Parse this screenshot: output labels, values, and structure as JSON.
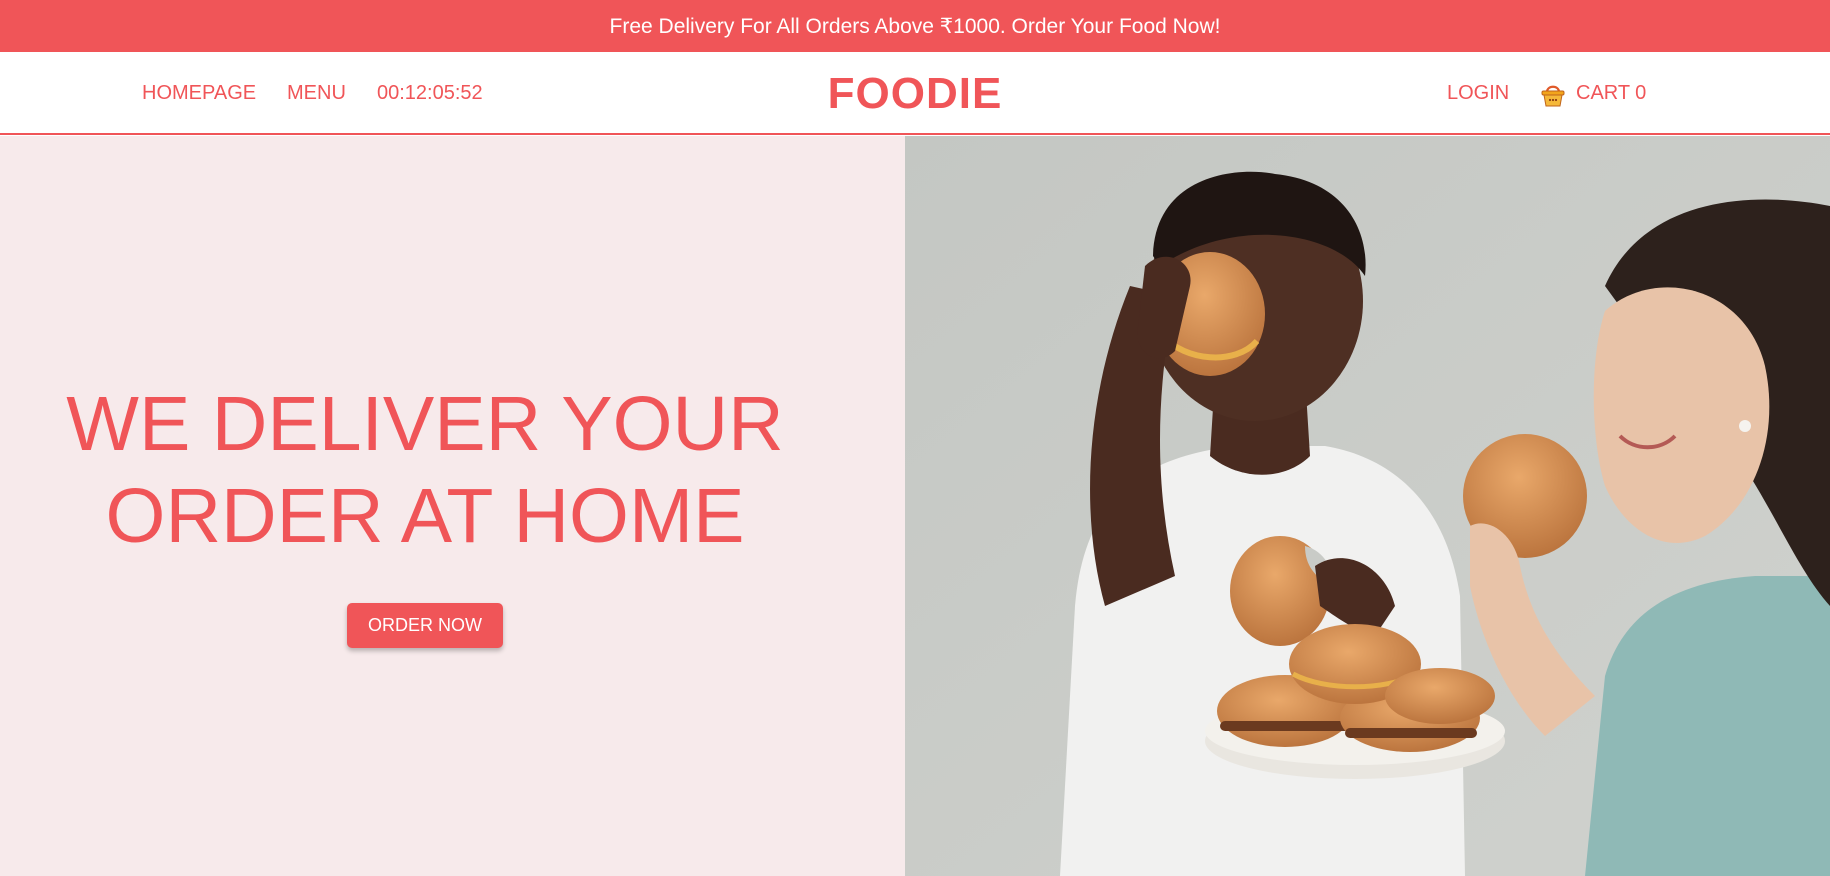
{
  "promo": {
    "text": "Free Delivery For All Orders Above ₹1000. Order Your Food Now!"
  },
  "nav": {
    "homepage": "HOMEPAGE",
    "menu": "MENU",
    "timer": "00:12:05:52",
    "brand": "FOODIE",
    "login": "LOGIN",
    "cart_label": "CART",
    "cart_count": "0",
    "cart_icon": "shopping-basket-icon"
  },
  "hero": {
    "title_line1": "WE DELIVER YOUR",
    "title_line2": "ORDER AT HOME",
    "cta": "ORDER NOW",
    "image": "photo-two-women-eating-burgers"
  },
  "colors": {
    "accent": "#f05558",
    "hero_bg": "#f7eaeb",
    "white": "#ffffff"
  }
}
